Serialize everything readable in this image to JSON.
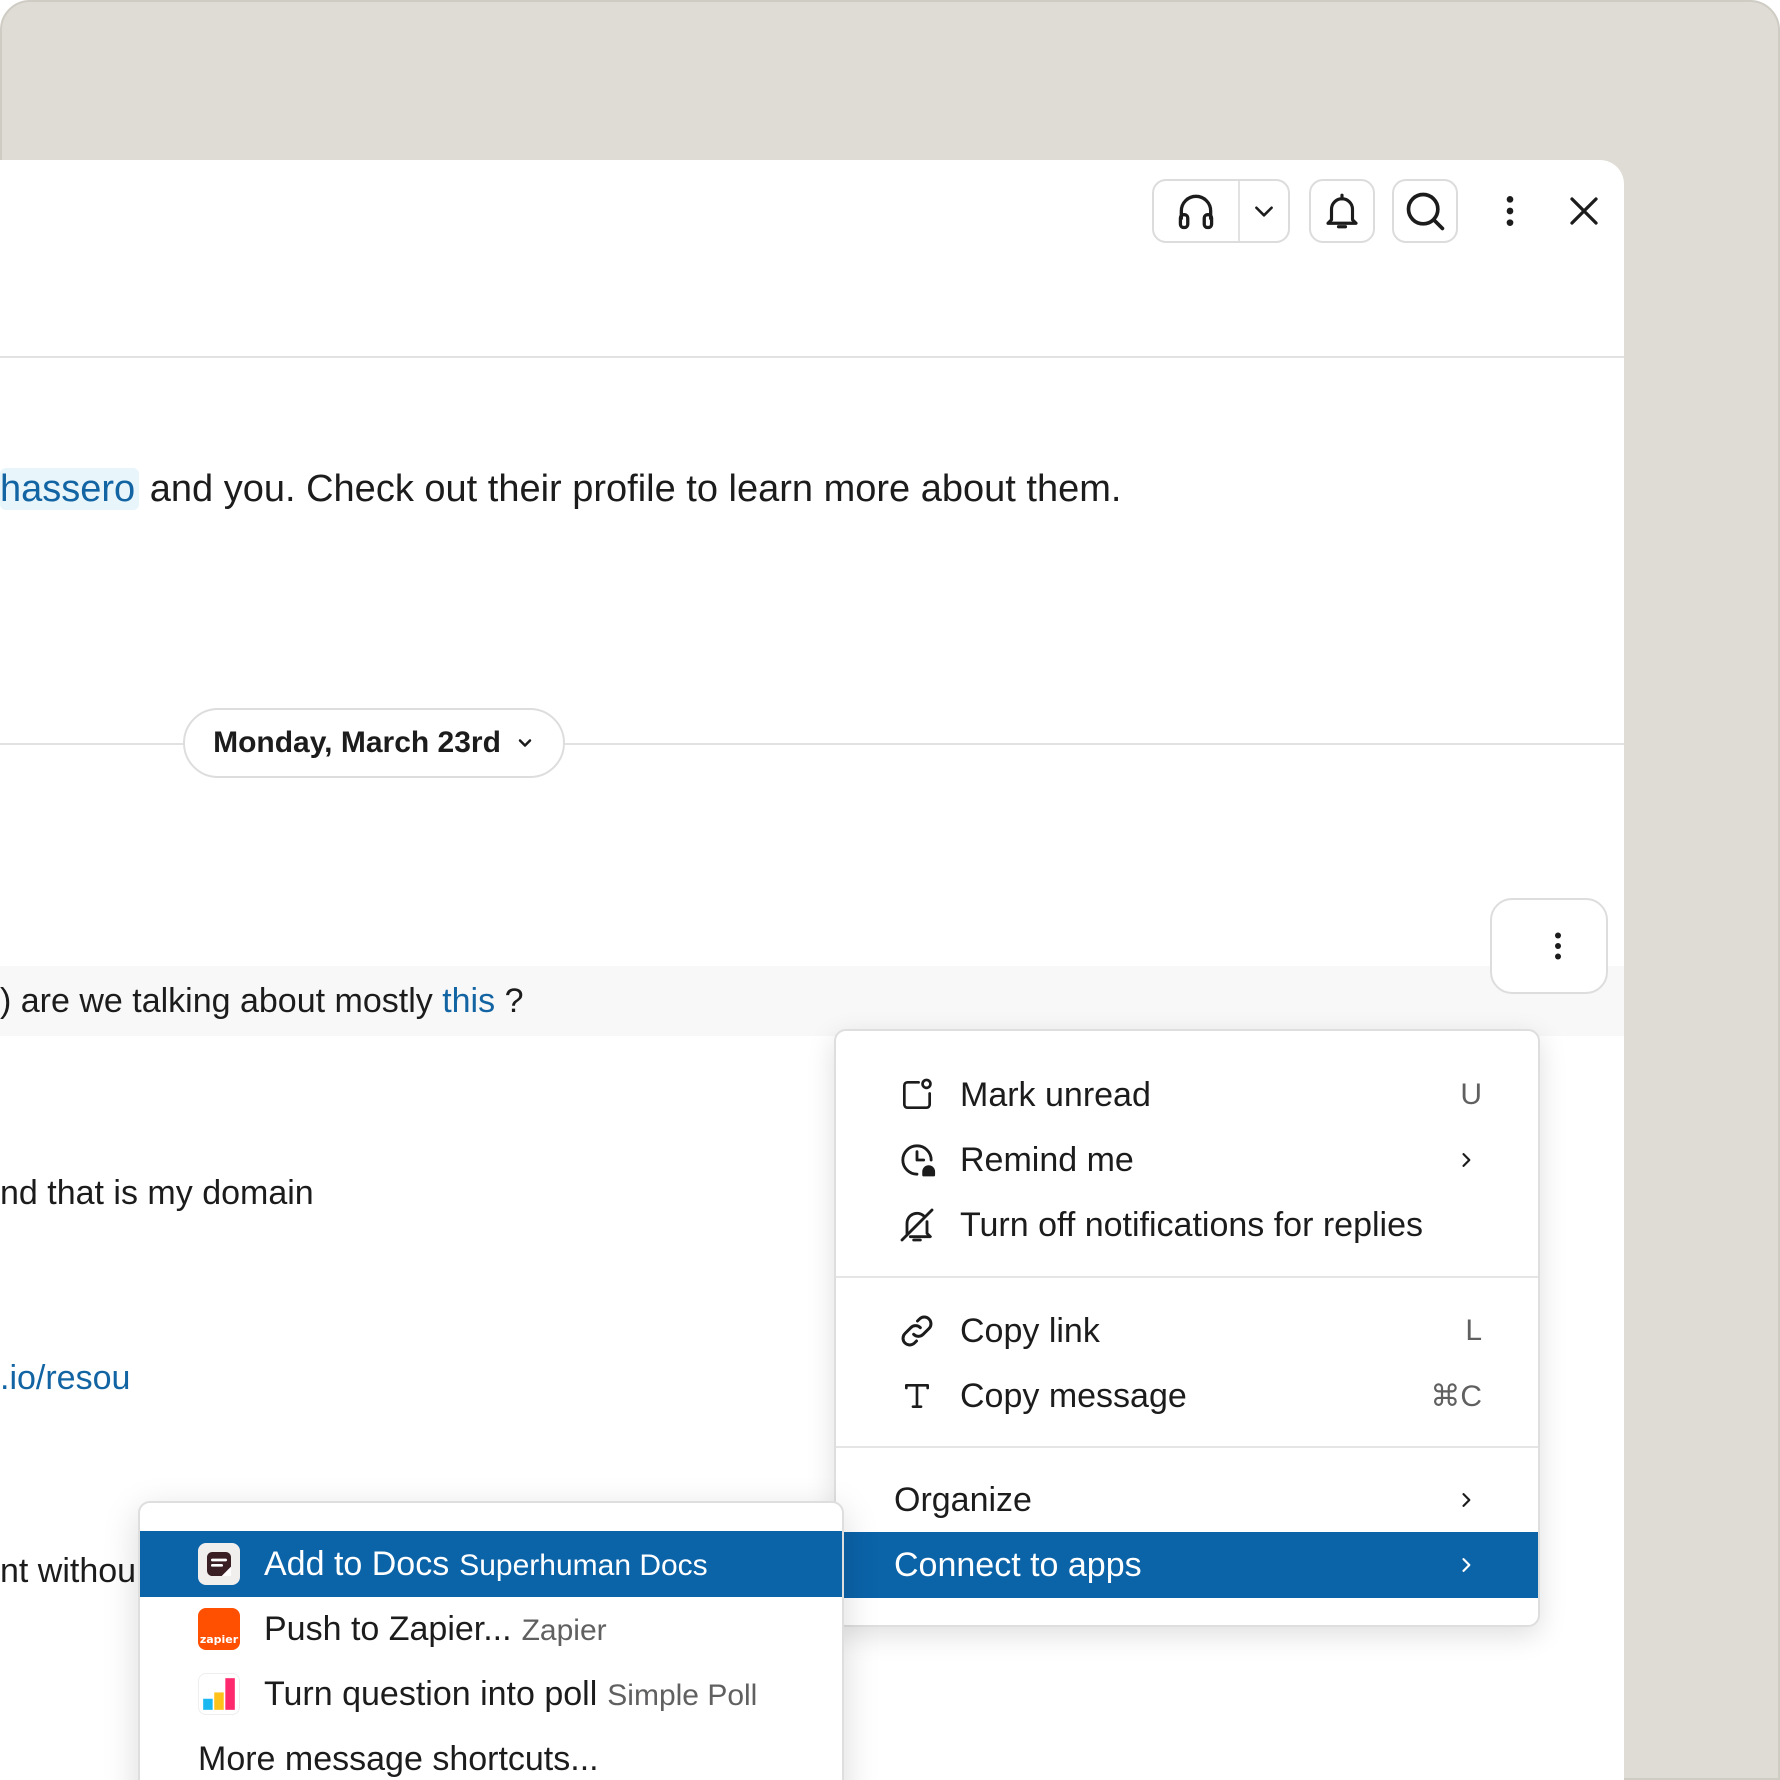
{
  "intro": {
    "mention": "hassero",
    "text": "and you. Check out their profile to learn more about them."
  },
  "date_divider": {
    "label": "Monday, March 23rd"
  },
  "messages": {
    "row1_prefix": ") are we talking about mostly ",
    "row1_link": "this",
    "row1_suffix": " ?",
    "row2": "nd that is my domain",
    "row3_link": ".io/resou",
    "row4": "nt withou"
  },
  "context_menu": {
    "mark_unread": {
      "label": "Mark unread",
      "shortcut": "U"
    },
    "remind_me": {
      "label": "Remind me"
    },
    "turn_off_notifications": {
      "label": "Turn off notifications for replies"
    },
    "copy_link": {
      "label": "Copy link",
      "shortcut": "L"
    },
    "copy_message": {
      "label": "Copy message",
      "shortcut": "⌘C"
    },
    "organize": {
      "label": "Organize"
    },
    "connect_to_apps": {
      "label": "Connect to apps"
    }
  },
  "submenu": {
    "items": [
      {
        "label": "Add to Docs",
        "app": "Superhuman Docs",
        "icon": "superhuman-docs-icon"
      },
      {
        "label": "Push to Zapier...",
        "app": "Zapier",
        "icon": "zapier-icon",
        "icon_text": "zapier"
      },
      {
        "label": "Turn question into poll",
        "app": "Simple Poll",
        "icon": "simple-poll-icon"
      }
    ],
    "more": "More message shortcuts..."
  },
  "colors": {
    "highlight": "#0b63a8",
    "link": "#1264a3",
    "backdrop": "#dedcd5",
    "zapier": "#ff4f00"
  }
}
